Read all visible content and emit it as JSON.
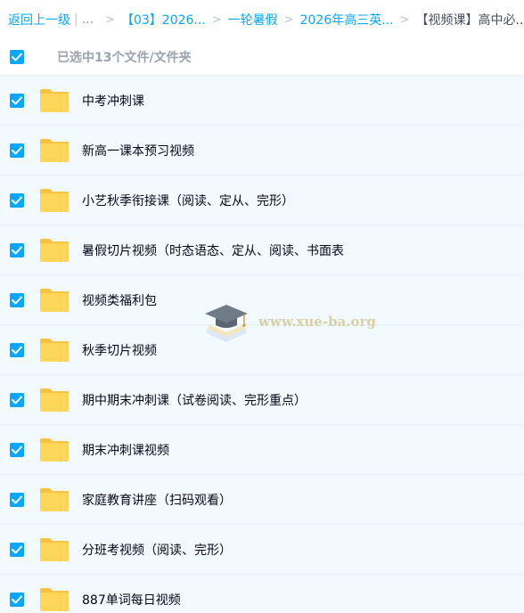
{
  "breadcrumb": {
    "back_label": "返回上一级",
    "separator": "|",
    "ellipsis": "...",
    "arrow": ">",
    "items": [
      {
        "label": "【03】2026..."
      },
      {
        "label": "一轮暑假"
      },
      {
        "label": "2026年高三英..."
      }
    ],
    "current": "【视频课】高中必..."
  },
  "selection": {
    "summary": "已选中13个文件/文件夹",
    "all_checked": true
  },
  "files": [
    {
      "name": "中考冲刺课",
      "checked": true,
      "icon": "folder-icon"
    },
    {
      "name": "新高一课本预习视频",
      "checked": true,
      "icon": "folder-icon"
    },
    {
      "name": "小艺秋季衔接课（阅读、定从、完形）",
      "checked": true,
      "icon": "folder-icon"
    },
    {
      "name": "暑假切片视频（时态语态、定从、阅读、书面表",
      "checked": true,
      "icon": "folder-icon"
    },
    {
      "name": "视频类福利包",
      "checked": true,
      "icon": "folder-icon"
    },
    {
      "name": "秋季切片视频",
      "checked": true,
      "icon": "folder-icon"
    },
    {
      "name": "期中期末冲刺课（试卷阅读、完形重点）",
      "checked": true,
      "icon": "folder-icon"
    },
    {
      "name": "期末冲刺课视频",
      "checked": true,
      "icon": "folder-icon"
    },
    {
      "name": "家庭教育讲座（扫码观看）",
      "checked": true,
      "icon": "folder-icon"
    },
    {
      "name": "分班考视频（阅读、完形）",
      "checked": true,
      "icon": "folder-icon"
    },
    {
      "name": "887单词每日视频",
      "checked": true,
      "icon": "folder-icon"
    }
  ],
  "watermark": {
    "text": "www.xue-ba.org",
    "icon": "graduation-cap-icon"
  },
  "colors": {
    "accent": "#06a7ff",
    "row_bg": "#f2f9ff",
    "folder": "#ffd55a"
  }
}
